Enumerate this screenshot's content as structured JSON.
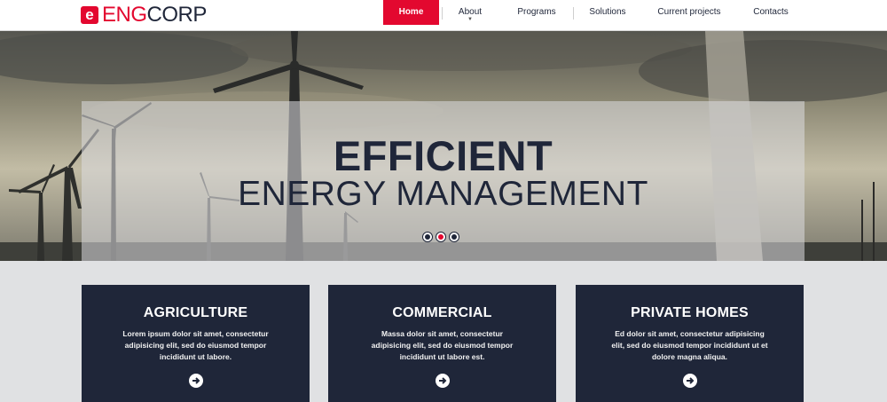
{
  "logo": {
    "badge": "e",
    "part1": "ENG",
    "part2": "CORP"
  },
  "nav": {
    "items": [
      {
        "label": "Home"
      },
      {
        "label": "About"
      },
      {
        "label": "Programs"
      },
      {
        "label": "Solutions"
      },
      {
        "label": "Current projects"
      },
      {
        "label": "Contacts"
      }
    ],
    "active_index": 0
  },
  "hero": {
    "title": "EFFICIENT",
    "subtitle": "ENERGY MANAGEMENT",
    "slide_count": 3,
    "active_slide": 2
  },
  "cards": [
    {
      "title": "AGRICULTURE",
      "text": "Lorem ipsum dolor sit amet, consectetur adipisicing elit, sed do eiusmod tempor incididunt ut labore."
    },
    {
      "title": "COMMERCIAL",
      "text": "Massa dolor sit amet, consectetur adipisicing elit, sed do eiusmod tempor incididunt ut labore est."
    },
    {
      "title": "PRIVATE HOMES",
      "text": "Ed dolor sit amet, consectetur adipisicing elit, sed do eiusmod tempor incididunt ut et dolore magna aliqua."
    }
  ],
  "colors": {
    "accent": "#e3082f",
    "dark": "#1f2639",
    "page_bg": "#e0e1e3"
  },
  "icons": {
    "dropdown": "chevron-down-icon",
    "card_link": "arrow-right-circle-icon"
  }
}
